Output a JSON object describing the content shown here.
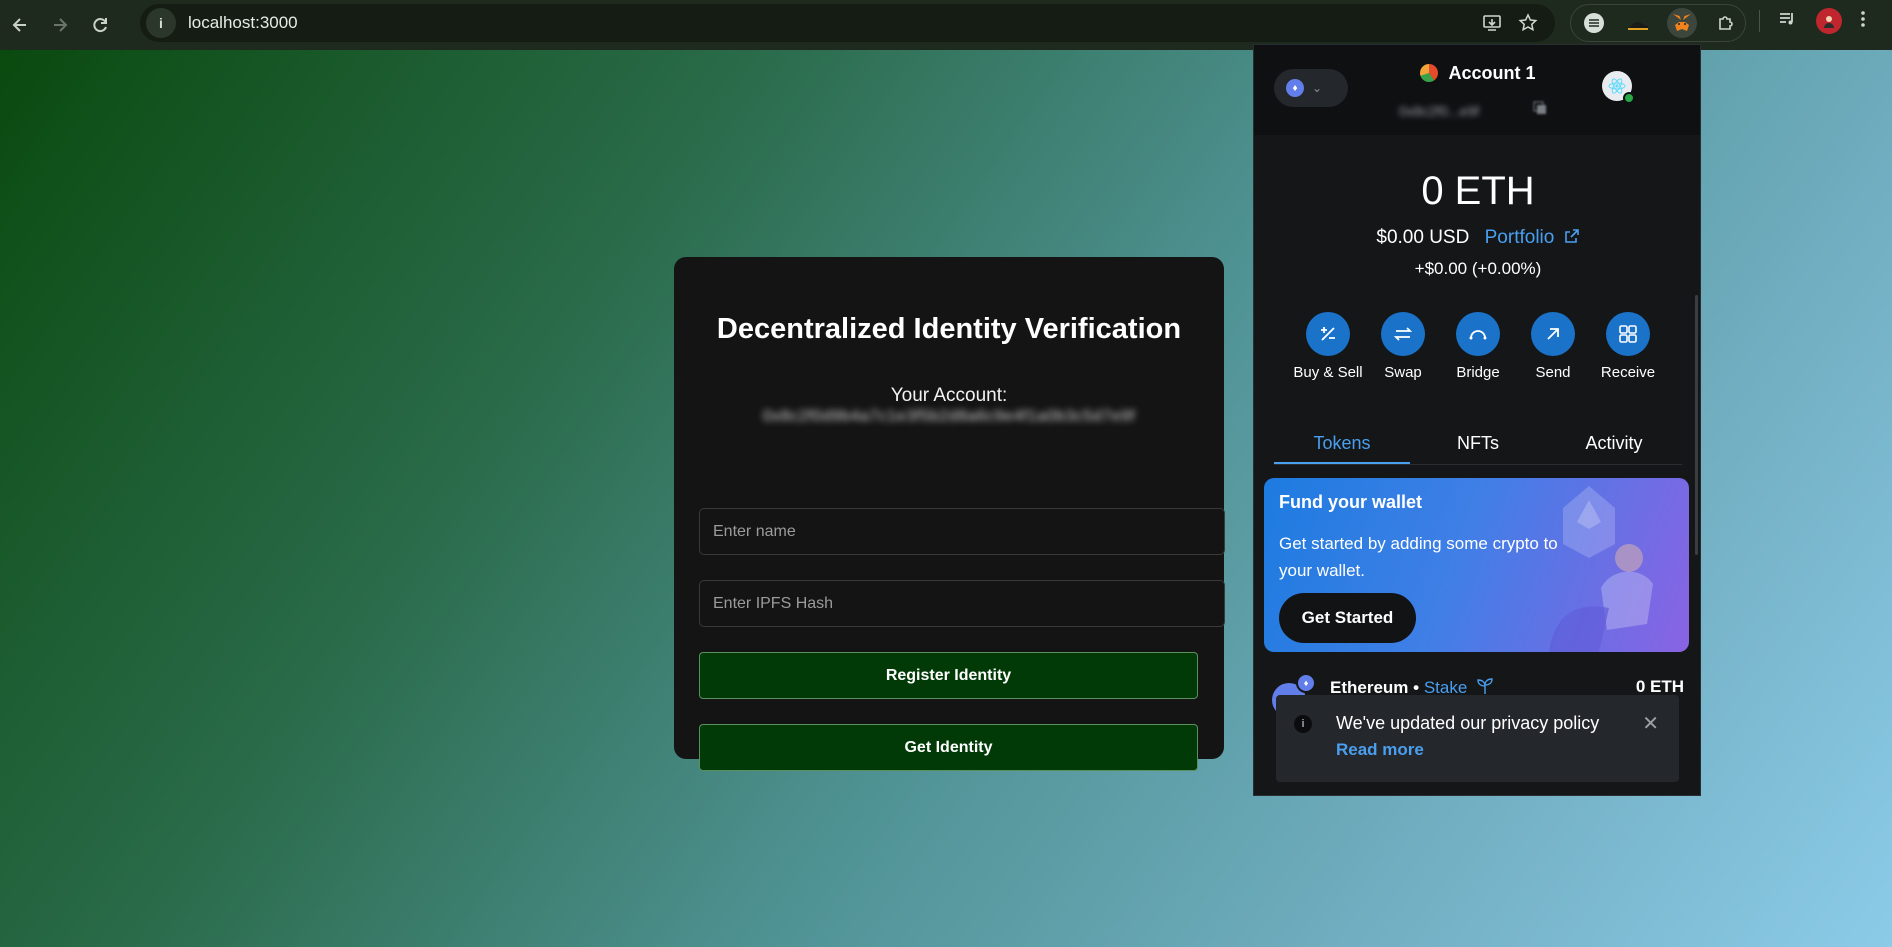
{
  "browser": {
    "url": "localhost:3000",
    "info_glyph": "i",
    "nav_icons": [
      "back-icon",
      "forward-icon",
      "reload-icon"
    ]
  },
  "card": {
    "title": "Decentralized Identity Verification",
    "account_label": "Your Account:",
    "account_address": "0x8c2f0d9b4a7c1e3f5b2d8a6c9e4f1a0b3c5d7e9f",
    "name_placeholder": "Enter name",
    "ipfs_placeholder": "Enter IPFS Hash",
    "register_label": "Register Identity",
    "get_label": "Get Identity",
    "colors": {
      "button_bg": "#023a07",
      "card_bg": "#141414"
    }
  },
  "metamask": {
    "account_name": "Account 1",
    "account_short": "0x8c2f0...e9f",
    "balance": "0 ETH",
    "balance_usd": "$0.00 USD",
    "portfolio_label": "Portfolio",
    "balance_change": "+$0.00 (+0.00%)",
    "actions": [
      {
        "label": "Buy & Sell",
        "icon": "buy-sell-icon"
      },
      {
        "label": "Swap",
        "icon": "swap-icon"
      },
      {
        "label": "Bridge",
        "icon": "bridge-icon"
      },
      {
        "label": "Send",
        "icon": "send-icon"
      },
      {
        "label": "Receive",
        "icon": "receive-icon"
      }
    ],
    "tabs": [
      "Tokens",
      "NFTs",
      "Activity"
    ],
    "active_tab": "Tokens",
    "fund": {
      "title": "Fund your wallet",
      "text": "Get started by adding some crypto to your wallet.",
      "button": "Get Started"
    },
    "token": {
      "name": "Ethereum",
      "separator": " • ",
      "stake": "Stake",
      "balance": "0 ETH"
    },
    "toast": {
      "text": "We've updated our privacy policy",
      "link": "Read more"
    },
    "colors": {
      "accent": "#4a9ff0",
      "action_bg": "#1a72c9"
    }
  }
}
